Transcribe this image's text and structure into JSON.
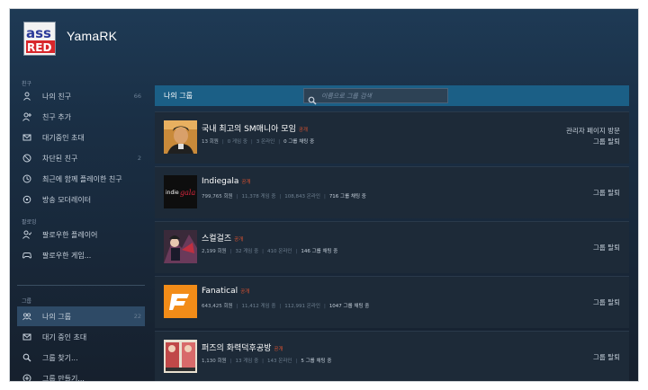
{
  "profile": {
    "name": "YamaRK"
  },
  "sidebar": {
    "friends_section": "친구",
    "friends": [
      {
        "label": "나의 친구",
        "count": "66",
        "icon": "person-icon"
      },
      {
        "label": "친구 추가",
        "count": "",
        "icon": "add-person-icon"
      },
      {
        "label": "대기중인 초대",
        "count": "",
        "icon": "mail-icon"
      },
      {
        "label": "차단된 친구",
        "count": "2",
        "icon": "block-icon"
      },
      {
        "label": "최근에 함께 플레이한 친구",
        "count": "",
        "icon": "clock-icon"
      },
      {
        "label": "방송 모더레이터",
        "count": "",
        "icon": "broadcast-icon"
      }
    ],
    "following_section": "팔로잉",
    "following": [
      {
        "label": "팔로우한 플레이어",
        "icon": "follow-person-icon"
      },
      {
        "label": "팔로우한 게임...",
        "icon": "gamepad-icon"
      }
    ],
    "groups_section": "그룹",
    "groups": [
      {
        "label": "나의 그룹",
        "count": "22",
        "icon": "group-icon",
        "active": true
      },
      {
        "label": "대기 중인 초대",
        "count": "",
        "icon": "mail-icon"
      },
      {
        "label": "그룹 찾기...",
        "count": "",
        "icon": "search-icon"
      },
      {
        "label": "그룹 만들기...",
        "count": "",
        "icon": "plus-circle-icon"
      }
    ]
  },
  "main": {
    "title": "나의 그룹",
    "search_placeholder": "이름으로 그룹 검색"
  },
  "groups": [
    {
      "name": "국내 최고의 SM매니아 모임",
      "visibility": "공개",
      "members": "13 회원",
      "in_game": "0 게임 중",
      "online": "3 온라인",
      "chatting": "0 그룹 채팅 중",
      "actions": [
        "관리자 페이지 방문",
        "그룹 탈퇴"
      ],
      "avatar": "photo-avatar"
    },
    {
      "name": "Indiegala",
      "visibility": "공개",
      "members": "799,765 회원",
      "in_game": "11,378 게임 중",
      "online": "108,843 온라인",
      "chatting": "716 그룹 채팅 중",
      "actions": [
        "그룹 탈퇴"
      ],
      "avatar": "indiegala-logo"
    },
    {
      "name": "스컬걸즈",
      "visibility": "공개",
      "members": "2,199 회원",
      "in_game": "32 게임 중",
      "online": "410 온라인",
      "chatting": "146 그룹 채팅 중",
      "actions": [
        "그룹 탈퇴"
      ],
      "avatar": "skullgirls-art"
    },
    {
      "name": "Fanatical",
      "visibility": "공개",
      "members": "643,425 회원",
      "in_game": "11,412 게임 중",
      "online": "112,991 온라인",
      "chatting": "1047 그룹 채팅 중",
      "actions": [
        "그룹 탈퇴"
      ],
      "avatar": "fanatical-logo"
    },
    {
      "name": "퍼즈의 화력덕후공방",
      "visibility": "공개",
      "members": "1,130 회원",
      "in_game": "13 게임 중",
      "online": "143 온라인",
      "chatting": "5 그룹 채팅 중",
      "actions": [
        "그룹 탈퇴"
      ],
      "avatar": "anime-art"
    }
  ],
  "colors": {
    "accent_bar": "#1b5f86",
    "public_tag": "#e0522e",
    "active_item": "#2e4a66"
  }
}
